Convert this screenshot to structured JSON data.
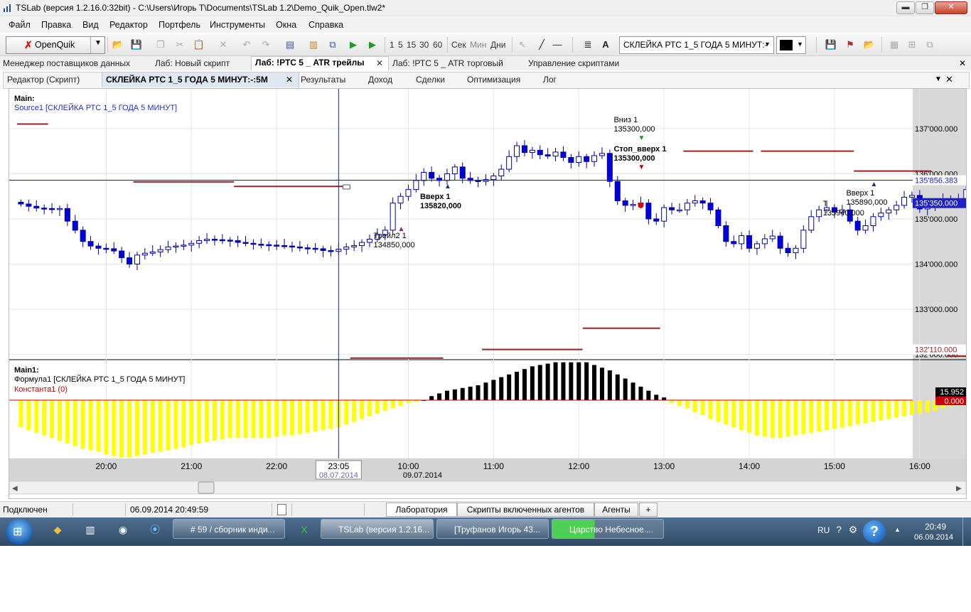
{
  "window": {
    "title": "TSLab (версия 1.2.16.0:32bit) - C:\\Users\\Игорь Т\\Documents\\TSLab 1.2\\Demo_Quik_Open.tlw2*",
    "minimize_glyph": "▬",
    "maximize_glyph": "❐",
    "close_glyph": "✕"
  },
  "menu": [
    "Файл",
    "Правка",
    "Вид",
    "Редактор",
    "Портфель",
    "Инструменты",
    "Окна",
    "Справка"
  ],
  "toolbar": {
    "provider_button": "OpenQuik",
    "timeframes": [
      "1",
      "5",
      "15",
      "30",
      "60"
    ],
    "units": [
      "Сек",
      "Мин",
      "Дни"
    ],
    "series_selector": "СКЛЕЙКА РТС 1_5 ГОДА 5 МИНУТ:-",
    "icons": [
      "open-folder-icon",
      "save-icon",
      "copy-icon",
      "cut-icon",
      "paste-icon",
      "delete-icon",
      "undo-icon",
      "redo-icon",
      "properties-icon",
      "bar-chart-icon",
      "network-icon",
      "play-icon",
      "step-play-icon",
      "cursor-icon",
      "line-tool-icon",
      "hline-tool-icon",
      "list-icon",
      "text-tool-icon",
      "save-gray-icon",
      "flag-icon",
      "open-gray-icon",
      "layout-icon",
      "split-icon",
      "window-icon"
    ]
  },
  "doc_tabs": [
    "Менеджер поставщиков данных",
    "Лаб: Новый скрипт",
    "Лаб: !РТС 5 _ ATR трейлы",
    "Лаб: !РТС 5 _ ATR торговый",
    "Управление скриптами"
  ],
  "sub_tabs": [
    "Редактор (Скрипт)",
    "СКЛЕЙКА РТС 1_5 ГОДА 5 МИНУТ:-:5M",
    "Результаты",
    "Доход",
    "Сделки",
    "Оптимизация",
    "Лог"
  ],
  "colors": {
    "candle_up_fill": "#ffffff",
    "candle_down_fill": "#0000dd",
    "candle_border": "#0000aa",
    "stop_line": "#9b2222",
    "histogram_positive": "#000000",
    "histogram_negative": "#ffff00",
    "crosshair": "#2020a0",
    "price_marker": "#2020cc",
    "zero_marker": "#cc0000"
  },
  "chart_data": {
    "type": "candlestick",
    "main_pane": {
      "title": "Main:",
      "source": "Source1 [СКЛЕЙКА РТС 1_5 ГОДА 5 МИНУТ]",
      "y_ticks": [
        "137'000.000",
        "136'000.000",
        "135'000.000",
        "134'000.000",
        "133'000.000",
        "132'000.000"
      ],
      "y_tick_values": [
        137000,
        136000,
        135000,
        134000,
        133000,
        132000
      ],
      "ylim": [
        131900,
        137800
      ],
      "price_labels": [
        {
          "text": "135'856.383",
          "value": 135856.383,
          "kind": "crosshair"
        },
        {
          "text": "135'350.000",
          "value": 135350,
          "kind": "last"
        },
        {
          "text": "132'110.000",
          "value": 132110,
          "kind": "stop"
        }
      ],
      "closes": [
        135330,
        135280,
        135240,
        135230,
        135210,
        135230,
        134950,
        134750,
        134500,
        134400,
        134350,
        134340,
        134290,
        134140,
        134000,
        134200,
        134240,
        134270,
        134320,
        134380,
        134400,
        134420,
        134460,
        134520,
        134550,
        134540,
        134530,
        134520,
        134480,
        134460,
        134440,
        134430,
        134420,
        134410,
        134400,
        134380,
        134360,
        134350,
        134340,
        134300,
        134280,
        134330,
        134380,
        134410,
        134480,
        134550,
        134650,
        134750,
        135350,
        135500,
        135650,
        135850,
        136030,
        135900,
        135850,
        136000,
        136150,
        135900,
        135850,
        135830,
        135870,
        135950,
        136100,
        136380,
        136620,
        136470,
        136520,
        136420,
        136390,
        136480,
        136360,
        136250,
        136380,
        136270,
        136400,
        136450,
        135830,
        135400,
        135300,
        135320,
        135350,
        135000,
        134950,
        135250,
        135200,
        135200,
        135350,
        135400,
        135350,
        135200,
        134850,
        134500,
        134450,
        134630,
        134350,
        134450,
        134560,
        134620,
        134350,
        134250,
        134350,
        134750,
        135050,
        135200,
        135250,
        135150,
        135200,
        134950,
        134750,
        134850,
        135050,
        135130,
        135200,
        135300,
        135480,
        135520,
        135220,
        135280,
        135350,
        135420,
        135430,
        135400,
        135650,
        135820,
        135950,
        136000,
        135800,
        135750,
        135870,
        135820,
        135800,
        135760,
        135350
      ],
      "stop_segments": [
        {
          "label": "stop-1",
          "from_bar": 0,
          "to_bar": 4,
          "value": 137100
        },
        {
          "label": "stop-2",
          "from_bar": 15,
          "to_bar": 28,
          "value": 135820
        },
        {
          "label": "stop-3",
          "from_bar": 28,
          "to_bar": 43,
          "value": 135720
        },
        {
          "label": "stop-4",
          "from_bar": 43,
          "to_bar": 55,
          "value": 131920
        },
        {
          "label": "stop-5",
          "from_bar": 60,
          "to_bar": 73,
          "value": 132110
        },
        {
          "label": "stop-6",
          "from_bar": 73,
          "to_bar": 83,
          "value": 132580
        },
        {
          "label": "stop-7",
          "from_bar": 86,
          "to_bar": 95,
          "value": 136500
        },
        {
          "label": "stop-8",
          "from_bar": 96,
          "to_bar": 108,
          "value": 136500
        },
        {
          "label": "stop-9",
          "from_bar": 108,
          "to_bar": 118,
          "value": 136060
        },
        {
          "label": "stop-10",
          "from_bar": 120,
          "to_bar": 127,
          "value": 131960
        }
      ],
      "annotations": [
        {
          "text": "Трейл2 1",
          "sub": "134850,000",
          "bar": 49,
          "bold": false
        },
        {
          "text": "Вверх 1",
          "sub": "135820,000",
          "bar": 55,
          "bold": true
        },
        {
          "text": "Вниз 1",
          "sub": "135300,000",
          "bar": 80,
          "bold": false
        },
        {
          "text": "Стоп_вверх 1",
          "sub": "135300,000",
          "bar": 80,
          "bold": true
        },
        {
          "text": "Вверх 1",
          "sub": "135890,000",
          "bar": 110,
          "bold": false
        },
        {
          "text": "Т",
          "sub": "135940,000",
          "bar": 107,
          "bold": false
        }
      ]
    },
    "indicator_pane": {
      "title": "Main1:",
      "series": [
        {
          "name": "Формула1 [СКЛЕЙКА РТС 1_5 ГОДА 5 МИНУТ]",
          "values": [
            -20,
            -22,
            -24,
            -26,
            -28,
            -30,
            -32,
            -34,
            -36,
            -37,
            -38,
            -40,
            -41,
            -42,
            -42,
            -41,
            -40,
            -39,
            -38,
            -37,
            -36,
            -35,
            -33,
            -32,
            -31,
            -30,
            -29,
            -28,
            -28,
            -28,
            -28,
            -28,
            -28,
            -27,
            -26,
            -26,
            -25,
            -24,
            -23,
            -22,
            -21,
            -20,
            -18,
            -16,
            -14,
            -12,
            -10,
            -8,
            -6,
            -4,
            -2,
            -1,
            0,
            3,
            5,
            7,
            8,
            9,
            10,
            11,
            13,
            15,
            17,
            19,
            21,
            23,
            25,
            26,
            27,
            28,
            28,
            28,
            28,
            28,
            26,
            24,
            22,
            19,
            16,
            13,
            10,
            7,
            4,
            2,
            -2,
            -4,
            -6,
            -9,
            -11,
            -14,
            -16,
            -18,
            -20,
            -22,
            -24,
            -26,
            -27,
            -28,
            -28,
            -27,
            -26,
            -25,
            -24,
            -23,
            -22,
            -21,
            -20,
            -19,
            -18,
            -17,
            -16,
            -15,
            -14,
            -13,
            -12,
            -11,
            -10,
            -9,
            -8,
            -6,
            -4,
            -2,
            5,
            6,
            7,
            8,
            8,
            8,
            8,
            8,
            7,
            6
          ]
        },
        {
          "name": "Константа1 (0)",
          "values": [
            0
          ]
        }
      ],
      "price_labels": [
        {
          "text": "15.952",
          "value": 15.952
        },
        {
          "text": "0.000",
          "value": 0
        }
      ]
    },
    "x_axis": {
      "ticks": [
        "20:00",
        "21:00",
        "22:00",
        "10:00",
        "11:00",
        "12:00",
        "13:00",
        "14:00",
        "15:00",
        "16:00"
      ],
      "tick_bars": [
        11,
        22,
        33,
        50,
        61,
        72,
        83,
        94,
        105,
        116
      ],
      "cursor_time": "23:05",
      "cursor_date": "08.07.2014",
      "cursor_bar": 41,
      "day_label": "09.07.2014",
      "day_bar": 50
    }
  },
  "status": {
    "connection": "Подключен",
    "datetime": "06.09.2014 20:49:59",
    "bottom_tabs": [
      "Лаборатория",
      "Скрипты включенных агентов",
      "Агенты"
    ],
    "add_tab": "+"
  },
  "taskbar": {
    "windows": [
      "# 59 / сборник инди...",
      "TSLab (версия 1.2.16...",
      "[Труфанов Игорь 43...",
      "Царство Небесное...."
    ],
    "lang": "RU",
    "time": "20:49",
    "date": "06.09.2014"
  }
}
